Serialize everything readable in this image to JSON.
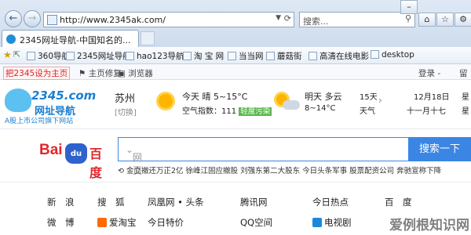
{
  "browser": {
    "url": "http://www.2345ak.com/",
    "search_placeholder": "搜索...",
    "tab_title": "2345网址导航-中国知名的..."
  },
  "favorites": [
    "360导航",
    "2345网址导航",
    "hao123导航",
    "淘 宝 网",
    "当当网",
    "蘑菇街",
    "高清在线电影",
    "desktop"
  ],
  "commandbar": {
    "sethome": "把2345设为主页",
    "fix": "主页修复",
    "browser": "浏览器",
    "login": "登录 -",
    "msg": "留"
  },
  "logo": {
    "line1": "2345.com",
    "line2": "网址导航",
    "sub": "A股上市公司旗下网站"
  },
  "weather": {
    "city": "苏州",
    "switch": "[切换]",
    "today": "今天  晴  5~15°C",
    "aqi_label": "空气指数：111",
    "aqi_tag": "轻度污染",
    "tomorrow": "明天  多云",
    "tomorrow_temp": "8~14°C",
    "days15": "15天",
    "weather_word": "天气",
    "date": "12月18日",
    "weekday": "星",
    "lunar": "十一月十七",
    "lunar2": "星"
  },
  "baidu": {
    "logo_left": "Bai",
    "logo_paw": "du",
    "logo_right": "百度",
    "input_label": "网页",
    "button": "搜索一下",
    "hot": "⟲ 金立撤还万正2亿   徐峰江固应撤股   刘强东第二大股东   今日头条军事   股票配资公司   奔驰宣称下降"
  },
  "sites": {
    "row1": [
      "新　浪",
      "搜　狐",
      "凤凰网 • 头条",
      "腾讯网",
      "今日热点",
      "百　度"
    ],
    "row2": [
      "微　博",
      "爱淘宝",
      "今日特价",
      "QQ空间",
      "电视剧",
      ""
    ]
  },
  "watermark": "爱例根知识网",
  "colors": {
    "baidu_blue": "#3b86e4",
    "baidu_red": "#e1272c",
    "accent": "#1b7fd0"
  }
}
